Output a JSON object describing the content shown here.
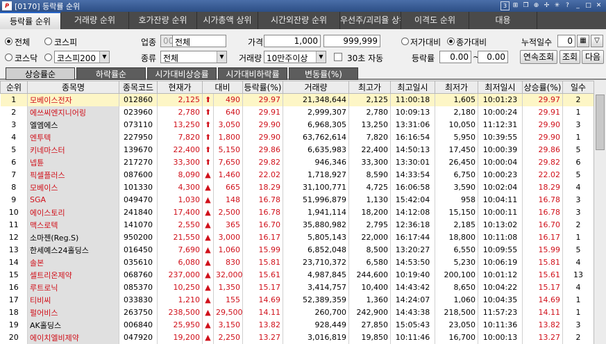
{
  "window": {
    "code": "[0170]",
    "title": "등락률 순위",
    "page_badge": "3",
    "help": "?"
  },
  "top_tabs": [
    "등락률 순위",
    "거래량 순위",
    "호가잔량 순위",
    "시가총액 상위",
    "시간외잔량 순위",
    "우선주/괴리율 상위",
    "이격도 순위",
    "대용"
  ],
  "filters": {
    "market": {
      "all": "전체",
      "kospi": "코스피",
      "kosdaq": "코스닥",
      "kospi200": "코스피200"
    },
    "industry_label": "업종",
    "industry_code": "0000",
    "industry_name": "전체",
    "type_label": "종류",
    "type_value": "전체",
    "price_label": "가격",
    "price_from": "1,000",
    "price_to": "999,999",
    "volume_label": "거래량",
    "volume_value": "10만주이상",
    "auto_label": "30초 자동",
    "rate_label": "등락률",
    "rate_from": "0.00",
    "rate_sep": "~",
    "rate_to": "0.00",
    "vs_low": "저가대비",
    "vs_close": "종가대비",
    "cum_days_label": "누적일수",
    "cum_days": "0",
    "continuous_btn": "연속조회",
    "query_btn": "조회",
    "next_btn": "다음"
  },
  "sub_tabs": [
    "상승률순",
    "하락률순",
    "시가대비상승률",
    "시가대비하락률",
    "변동률(%)"
  ],
  "columns": [
    "순위",
    "종목명",
    "종목코드",
    "현재가",
    "대비",
    "등락률(%)",
    "거래량",
    "최고가",
    "최고일시",
    "최저가",
    "최저일시",
    "상승률(%)",
    "일수"
  ],
  "rows": [
    [
      "1",
      "모베이스전자",
      "012860",
      "2,125",
      "⬆",
      "490",
      "29.97",
      "21,348,644",
      "2,125",
      "11:00:18",
      "1,605",
      "10:01:23",
      "29.97",
      "2"
    ],
    [
      "2",
      "에쓰씨엔지니어링",
      "023960",
      "2,780",
      "⬆",
      "640",
      "29.91",
      "2,999,307",
      "2,780",
      "10:09:13",
      "2,180",
      "10:00:24",
      "29.91",
      "1"
    ],
    [
      "3",
      "엘엠에스",
      "073110",
      "13,250",
      "⬆",
      "3,050",
      "29.90",
      "6,968,305",
      "13,250",
      "13:31:06",
      "10,050",
      "11:12:31",
      "29.90",
      "3"
    ],
    [
      "4",
      "엔투텍",
      "227950",
      "7,820",
      "⬆",
      "1,800",
      "29.90",
      "63,762,614",
      "7,820",
      "16:16:54",
      "5,950",
      "10:39:55",
      "29.90",
      "1"
    ],
    [
      "5",
      "키네마스터",
      "139670",
      "22,400",
      "⬆",
      "5,150",
      "29.86",
      "6,635,983",
      "22,400",
      "14:50:13",
      "17,450",
      "10:00:39",
      "29.86",
      "5"
    ],
    [
      "6",
      "넵튠",
      "217270",
      "33,300",
      "⬆",
      "7,650",
      "29.82",
      "946,346",
      "33,300",
      "13:30:01",
      "26,450",
      "10:00:04",
      "29.82",
      "6"
    ],
    [
      "7",
      "픽셀플러스",
      "087600",
      "8,090",
      "▲",
      "1,460",
      "22.02",
      "1,718,927",
      "8,590",
      "14:33:54",
      "6,750",
      "10:00:23",
      "22.02",
      "5"
    ],
    [
      "8",
      "모베이스",
      "101330",
      "4,300",
      "▲",
      "665",
      "18.29",
      "31,100,771",
      "4,725",
      "16:06:58",
      "3,590",
      "10:02:04",
      "18.29",
      "4"
    ],
    [
      "9",
      "SGA",
      "049470",
      "1,030",
      "▲",
      "148",
      "16.78",
      "51,996,879",
      "1,130",
      "15:42:04",
      "958",
      "10:04:11",
      "16.78",
      "3"
    ],
    [
      "10",
      "에이스토리",
      "241840",
      "17,400",
      "▲",
      "2,500",
      "16.78",
      "1,941,114",
      "18,200",
      "14:12:08",
      "15,150",
      "10:00:11",
      "16.78",
      "3"
    ],
    [
      "11",
      "맥스로텍",
      "141070",
      "2,550",
      "▲",
      "365",
      "16.70",
      "35,880,982",
      "2,795",
      "12:36:18",
      "2,185",
      "10:13:02",
      "16.70",
      "2"
    ],
    [
      "12",
      "소마젠(Reg.S)",
      "950200",
      "21,550",
      "▲",
      "3,000",
      "16.17",
      "5,805,143",
      "22,000",
      "16:17:44",
      "18,800",
      "10:11:08",
      "16.17",
      "1"
    ],
    [
      "13",
      "한세예스24홀딩스",
      "016450",
      "7,690",
      "▲",
      "1,060",
      "15.99",
      "6,852,048",
      "8,500",
      "13:20:27",
      "6,550",
      "10:09:55",
      "15.99",
      "5"
    ],
    [
      "14",
      "솔본",
      "035610",
      "6,080",
      "▲",
      "830",
      "15.81",
      "23,710,372",
      "6,580",
      "14:53:50",
      "5,230",
      "10:06:19",
      "15.81",
      "4"
    ],
    [
      "15",
      "셀트리온제약",
      "068760",
      "237,000",
      "▲",
      "32,000",
      "15.61",
      "4,987,845",
      "244,600",
      "10:19:40",
      "200,100",
      "10:01:12",
      "15.61",
      "13"
    ],
    [
      "16",
      "루트로닉",
      "085370",
      "10,250",
      "▲",
      "1,350",
      "15.17",
      "3,414,757",
      "10,400",
      "14:43:42",
      "8,650",
      "10:04:22",
      "15.17",
      "4"
    ],
    [
      "17",
      "티비씨",
      "033830",
      "1,210",
      "▲",
      "155",
      "14.69",
      "52,389,359",
      "1,360",
      "14:24:07",
      "1,060",
      "10:04:35",
      "14.69",
      "1"
    ],
    [
      "18",
      "펄어비스",
      "263750",
      "238,500",
      "▲",
      "29,500",
      "14.11",
      "260,700",
      "242,900",
      "14:43:38",
      "218,500",
      "11:57:23",
      "14.11",
      "1"
    ],
    [
      "19",
      "AK홀딩스",
      "006840",
      "25,950",
      "▲",
      "3,150",
      "13.82",
      "928,449",
      "27,850",
      "15:05:43",
      "23,050",
      "10:11:36",
      "13.82",
      "3"
    ],
    [
      "20",
      "에이치엘비제약",
      "047920",
      "19,200",
      "▲",
      "2,250",
      "13.27",
      "3,016,819",
      "19,850",
      "10:11:46",
      "16,700",
      "10:00:13",
      "13.27",
      "2"
    ]
  ],
  "colors": {
    "up": "#d0101a",
    "selected_row": "#fdf6c6",
    "tab_bar": "#4a4a4a"
  }
}
